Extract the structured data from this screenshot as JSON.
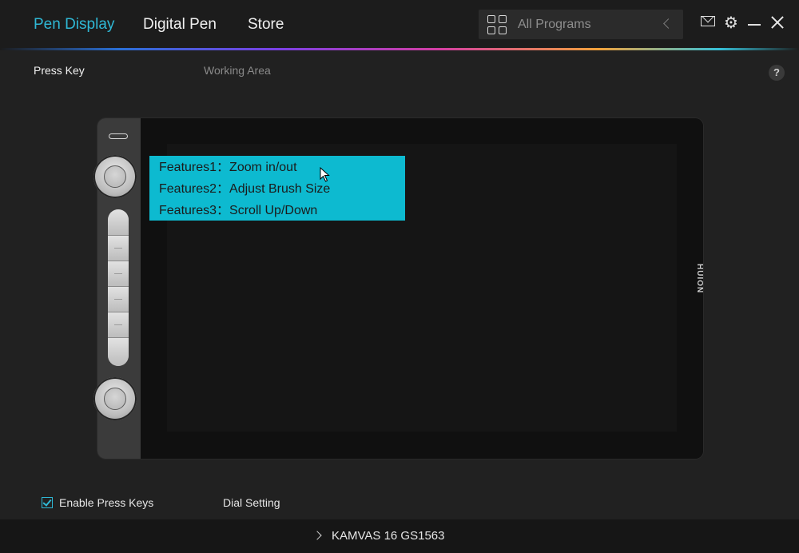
{
  "nav": {
    "tabs": [
      {
        "label": "Pen Display",
        "active": true
      },
      {
        "label": "Digital Pen",
        "active": false
      },
      {
        "label": "Store",
        "active": false
      }
    ],
    "program_select": {
      "value": "All Programs",
      "icon": "grid-icon"
    }
  },
  "window_controls": [
    "mail-icon",
    "gear-icon",
    "minimize-icon",
    "close-icon"
  ],
  "subtabs": [
    {
      "label": "Press Key",
      "active": true
    },
    {
      "label": "Working Area",
      "active": false
    }
  ],
  "help": {
    "label": "?"
  },
  "device": {
    "brand": "HUION",
    "tooltip": {
      "lines": [
        "Features1：Zoom in/out",
        "Features2：Adjust Brush Size",
        "Features3：Scroll Up/Down"
      ]
    }
  },
  "bottom": {
    "enable_press_keys": {
      "label": "Enable Press Keys",
      "checked": true
    },
    "dial_setting": "Dial Setting"
  },
  "status": {
    "device_name": "KAMVAS 16 GS1563"
  },
  "colors": {
    "accent": "#2fb8d5",
    "tooltip_bg": "#0dbad0",
    "background": "#212121"
  }
}
